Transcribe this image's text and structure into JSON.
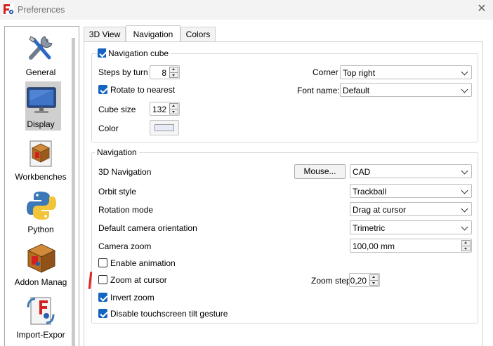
{
  "window": {
    "title": "Preferences",
    "close_icon": "close-icon",
    "app_icon": "freecad-icon"
  },
  "sidebar": {
    "items": [
      {
        "label": "General",
        "icon": "tools-icon"
      },
      {
        "label": "Display",
        "icon": "monitor-icon",
        "selected": true
      },
      {
        "label": "Workbenches",
        "icon": "workbench-box-icon"
      },
      {
        "label": "Python",
        "icon": "python-icon"
      },
      {
        "label": "Addon Manag",
        "icon": "addon-box-icon"
      },
      {
        "label": "Import-Expor",
        "icon": "import-export-icon"
      }
    ]
  },
  "tabs": [
    {
      "label": "3D View"
    },
    {
      "label": "Navigation",
      "active": true
    },
    {
      "label": "Colors"
    }
  ],
  "navigation_cube": {
    "enabled_label": "Navigation cube",
    "enabled": true,
    "steps_label": "Steps by turn",
    "steps_value": "8",
    "rotate_label": "Rotate to nearest",
    "rotate_checked": true,
    "cube_size_label": "Cube size",
    "cube_size_value": "132",
    "color_label": "Color",
    "color_value": "#e6ecf7",
    "corner_label": "Corner",
    "corner_value": "Top right",
    "font_label": "Font name:",
    "font_value": "Default"
  },
  "navigation": {
    "group_label": "Navigation",
    "nav3d_label": "3D Navigation",
    "mouse_button": "Mouse...",
    "nav3d_value": "CAD",
    "orbit_label": "Orbit style",
    "orbit_value": "Trackball",
    "rotation_label": "Rotation mode",
    "rotation_value": "Drag at cursor",
    "orientation_label": "Default camera orientation",
    "orientation_value": "Trimetric",
    "zoom_label": "Camera zoom",
    "zoom_value": "100,00 mm",
    "anim_label": "Enable animation",
    "anim_checked": false,
    "zoom_cursor_label": "Zoom at cursor",
    "zoom_cursor_checked": false,
    "zoom_step_label": "Zoom step",
    "zoom_step_value": "0,20",
    "invert_label": "Invert zoom",
    "invert_checked": true,
    "tilt_label": "Disable touchscreen tilt gesture",
    "tilt_checked": true
  },
  "colors": {
    "accent": "#1565c0",
    "annotation_mark": "#e32020",
    "selection": "#cfcfcf"
  }
}
